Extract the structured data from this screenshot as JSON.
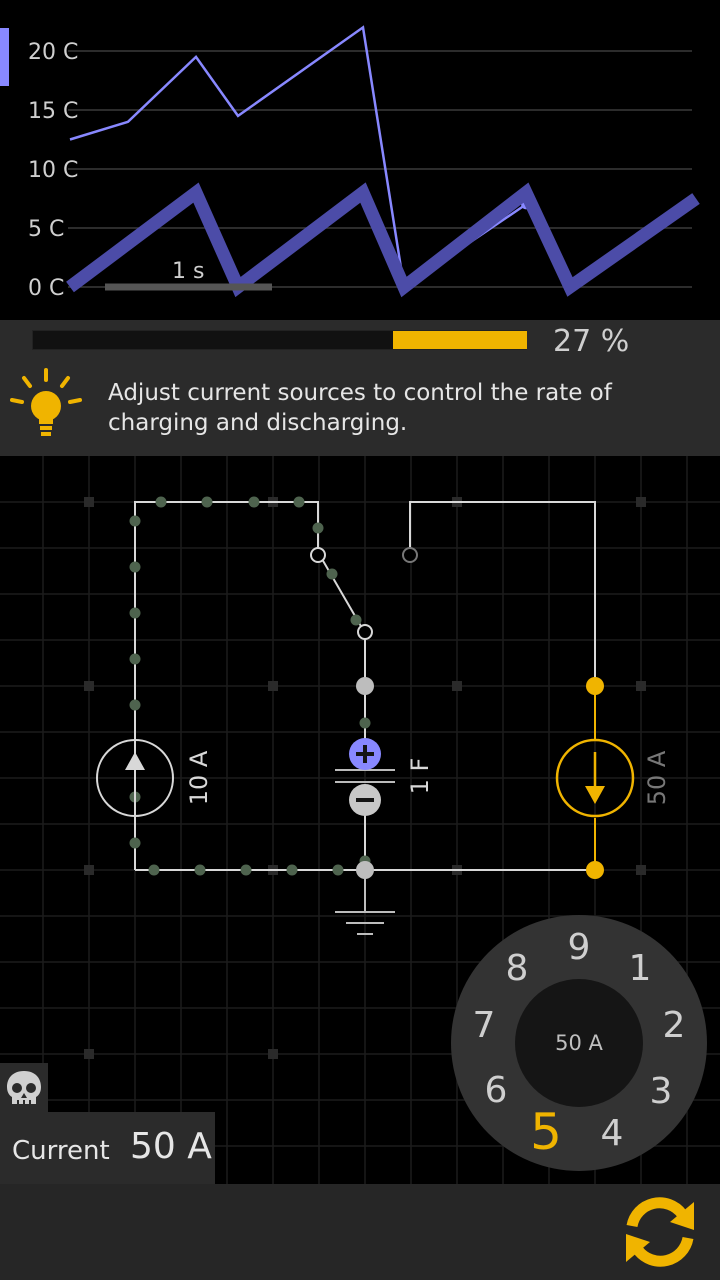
{
  "chart": {
    "y_ticks": [
      "20 C",
      "15 C",
      "10 C",
      "5 C",
      "0 C"
    ],
    "time_scale_label": "1 s"
  },
  "chart_data": {
    "type": "line",
    "y_unit": "C",
    "ylim": [
      0,
      22
    ],
    "grid": true,
    "series": [
      {
        "color": "#8888ff",
        "values": [
          [
            0,
            12.5
          ],
          [
            1,
            14
          ],
          [
            2,
            19.5
          ],
          [
            3,
            14.5
          ],
          [
            4,
            22
          ],
          [
            5,
            0
          ],
          [
            6,
            7
          ]
        ]
      },
      {
        "color": "#4c4ca8",
        "values": [
          [
            0,
            0
          ],
          [
            1,
            8
          ],
          [
            2,
            0
          ],
          [
            3,
            8
          ],
          [
            4,
            0
          ],
          [
            5,
            8
          ],
          [
            6,
            0
          ],
          [
            7,
            7.5
          ]
        ]
      }
    ]
  },
  "progress": {
    "value": 0.27,
    "label": "27 %",
    "fill_color": "#f0b400"
  },
  "hint": {
    "icon": "lightbulb-icon",
    "text": "Adjust current sources to control the rate of charging and discharging."
  },
  "circuit": {
    "source_left_label": "10 A",
    "capacitor_label": "1 F",
    "source_right_label": "50 A",
    "accent": "#f0b400",
    "charge_color": "#8888ff"
  },
  "dial": {
    "center_label": "50 A",
    "numbers": [
      "9",
      "1",
      "2",
      "3",
      "4",
      "5",
      "6",
      "7",
      "8"
    ],
    "selected": "5"
  },
  "current_panel": {
    "label": "Current",
    "value": "50 A"
  },
  "icons": {
    "skull": "skull-icon",
    "reset": "refresh-icon"
  }
}
